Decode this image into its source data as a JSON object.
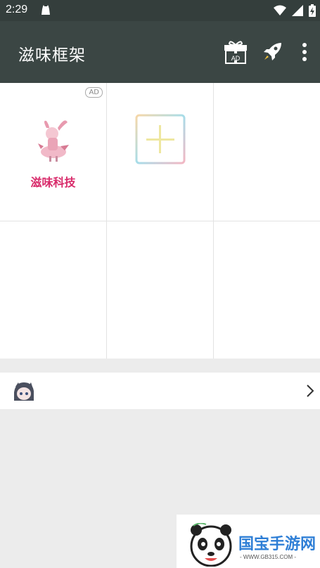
{
  "status_bar": {
    "time": "2:29",
    "icons": [
      "notification-icon",
      "wifi-icon",
      "cell-signal-icon",
      "battery-icon"
    ]
  },
  "app_bar": {
    "title": "滋味框架",
    "actions": [
      "gift-ad-icon",
      "rocket-icon",
      "more-vert-icon"
    ],
    "gift_badge": "AD"
  },
  "grid": {
    "cells": [
      {
        "type": "app",
        "name": "滋味科技",
        "badge": "AD",
        "icon": "app-icon"
      },
      {
        "type": "add",
        "icon": "add-icon"
      },
      {
        "type": "empty"
      },
      {
        "type": "empty"
      },
      {
        "type": "empty"
      },
      {
        "type": "empty"
      }
    ]
  },
  "list_row": {
    "avatar": "avatar-icon",
    "chevron": "chevron-right-icon"
  },
  "watermark": {
    "title": "国宝手游网",
    "subtitle": "- WWW.GB315.COM -"
  },
  "colors": {
    "status_bar": "#343e3c",
    "app_bar": "#3b4644",
    "app_name": "#d82a6a",
    "background": "#ececec"
  }
}
